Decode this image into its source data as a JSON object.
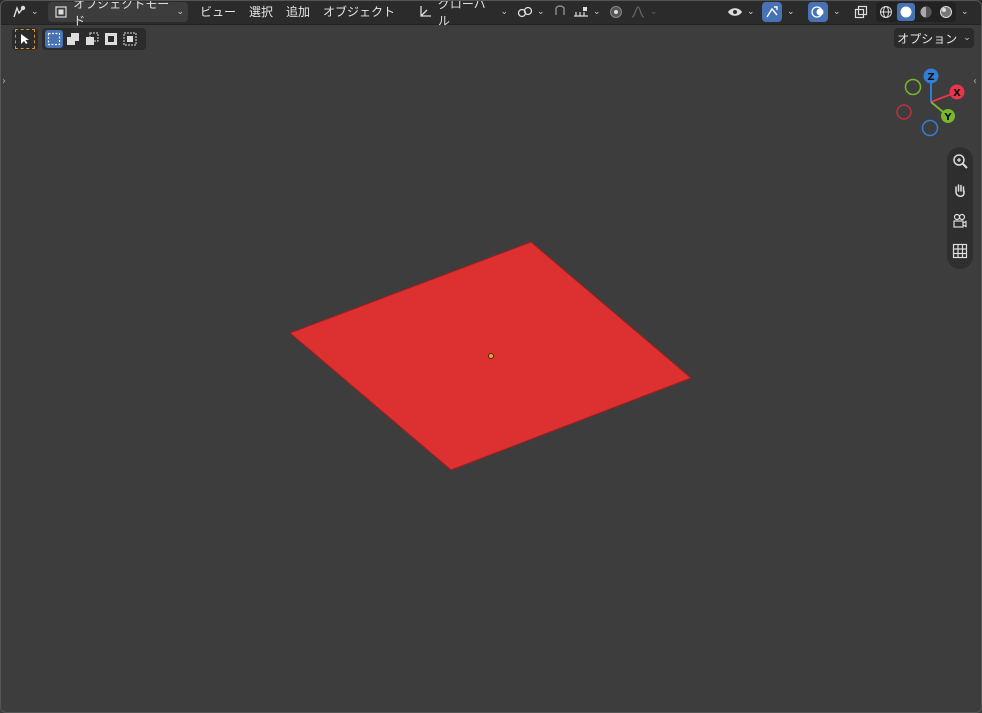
{
  "header": {
    "mode_label": "オブジェクトモード",
    "menus": [
      "ビュー",
      "選択",
      "追加",
      "オブジェクト"
    ],
    "transform_orientation": "グローバル",
    "options_label": "オプション"
  },
  "gizmo": {
    "axes": [
      "Z",
      "X",
      "Y"
    ],
    "colors": {
      "x": "#e8344c",
      "y": "#78b82a",
      "z": "#2f7fd6"
    }
  },
  "viewport": {
    "background": "#3d3d3d",
    "object_color": "#dd3030"
  }
}
